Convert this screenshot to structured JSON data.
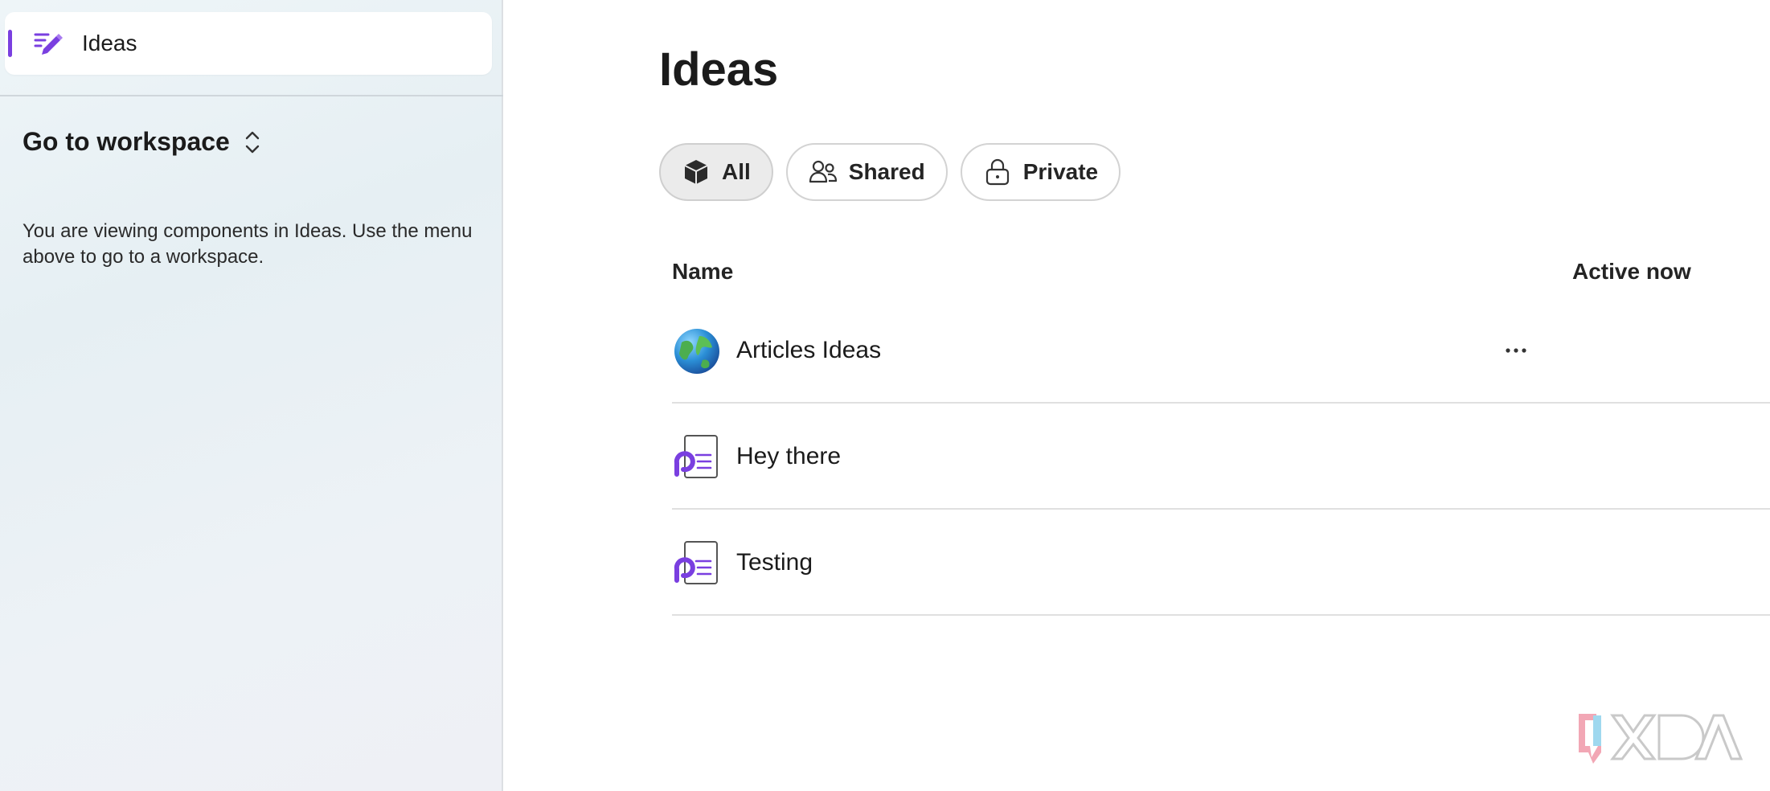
{
  "sidebar": {
    "nav_item": {
      "label": "Ideas",
      "icon": "pen-icon"
    },
    "workspace_switch": {
      "label": "Go to workspace",
      "icon": "chevron-up-down-icon"
    },
    "note": "You are viewing components in Ideas. Use the menu above to go to a workspace."
  },
  "main": {
    "title": "Ideas",
    "filters": [
      {
        "label": "All",
        "icon": "cube-icon",
        "selected": true
      },
      {
        "label": "Shared",
        "icon": "people-icon",
        "selected": false
      },
      {
        "label": "Private",
        "icon": "lock-icon",
        "selected": false
      }
    ],
    "columns": {
      "name": "Name",
      "active": "Active now"
    },
    "rows": [
      {
        "label": "Articles Ideas",
        "icon": "globe-icon",
        "more": "more-options-icon"
      },
      {
        "label": "Hey there",
        "icon": "loop-page-icon"
      },
      {
        "label": "Testing",
        "icon": "loop-page-icon"
      }
    ]
  },
  "watermark": {
    "text": "XDA"
  },
  "colors": {
    "accent": "#7a3fe0",
    "divider": "#e0e0e0"
  }
}
